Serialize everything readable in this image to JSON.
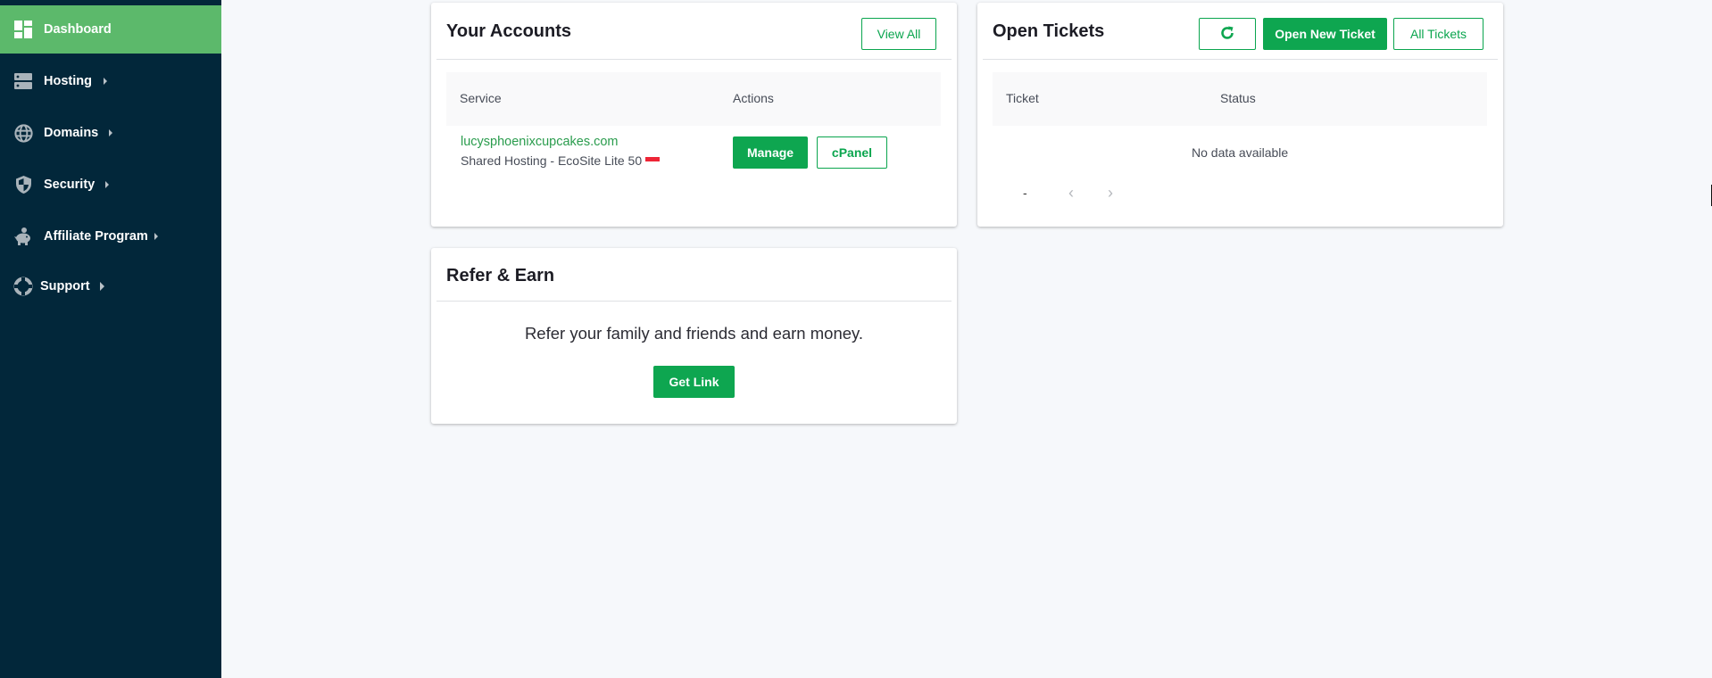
{
  "sidebar": {
    "items": [
      {
        "label": "Dashboard",
        "icon": "dashboard-icon",
        "active": true,
        "has_submenu": false
      },
      {
        "label": "Hosting",
        "icon": "server-icon",
        "active": false,
        "has_submenu": true
      },
      {
        "label": "Domains",
        "icon": "globe-icon",
        "active": false,
        "has_submenu": true
      },
      {
        "label": "Security",
        "icon": "shield-icon",
        "active": false,
        "has_submenu": true
      },
      {
        "label": "Affiliate Program",
        "icon": "piggy-bank-icon",
        "active": false,
        "has_submenu": true
      },
      {
        "label": "Support",
        "icon": "lifebuoy-icon",
        "active": false,
        "has_submenu": true
      }
    ]
  },
  "accounts": {
    "title": "Your Accounts",
    "view_all_label": "View All",
    "columns": [
      "Service",
      "Actions"
    ],
    "rows": [
      {
        "domain": "lucysphoenixcupcakes.com",
        "plan": "Shared Hosting - EcoSite Lite 50",
        "flag": "Singapore",
        "actions": [
          "Manage",
          "cPanel"
        ]
      }
    ]
  },
  "tickets": {
    "title": "Open Tickets",
    "refresh_icon": "refresh-icon",
    "open_new_label": "Open New Ticket",
    "all_tickets_label": "All Tickets",
    "columns": [
      "Ticket",
      "Status"
    ],
    "empty_text": "No data available",
    "pagination": {
      "range_text": "-",
      "prev_icon": "chevron-left-icon",
      "next_icon": "chevron-right-icon"
    }
  },
  "refer": {
    "title": "Refer & Earn",
    "description": "Refer your family and friends and earn money.",
    "button_label": "Get Link"
  },
  "colors": {
    "sidebar_bg": "#02273a",
    "sidebar_active": "#5cb96b",
    "primary_green": "#0ea650",
    "link_green": "#2a9c4d",
    "page_bg": "#f6f8fb"
  }
}
